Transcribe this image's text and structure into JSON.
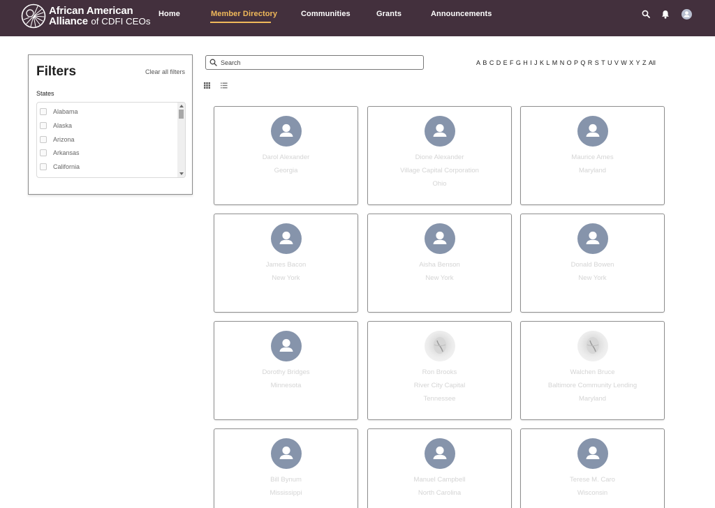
{
  "header": {
    "logo": {
      "line1": "African American",
      "line2": "Alliance",
      "line2_small": "of CDFI CEOs"
    },
    "nav": [
      "Home",
      "Member Directory",
      "Communities",
      "Grants",
      "Announcements"
    ],
    "active_nav": "Member Directory",
    "icons": [
      "search-icon",
      "bell-icon",
      "user-avatar-icon"
    ]
  },
  "filters": {
    "title": "Filters",
    "clear_label": "Clear all filters",
    "states_label": "States",
    "states": [
      "Alabama",
      "Alaska",
      "Arizona",
      "Arkansas",
      "California"
    ]
  },
  "search": {
    "placeholder": "Search"
  },
  "alphabet": [
    "A",
    "B",
    "C",
    "D",
    "E",
    "F",
    "G",
    "H",
    "I",
    "J",
    "K",
    "L",
    "M",
    "N",
    "O",
    "P",
    "Q",
    "R",
    "S",
    "T",
    "U",
    "V",
    "W",
    "X",
    "Y",
    "Z",
    "All"
  ],
  "view_icons": [
    "grid-view-icon",
    "list-view-icon"
  ],
  "members": [
    {
      "name": "Darol Alexander",
      "org": "",
      "state": "Georgia",
      "avatar": "default"
    },
    {
      "name": "Dione Alexander",
      "org": "Village Capital Corporation",
      "state": "Ohio",
      "avatar": "default"
    },
    {
      "name": "Maurice Ames",
      "org": "",
      "state": "Maryland",
      "avatar": "default"
    },
    {
      "name": "James Bacon",
      "org": "",
      "state": "New York",
      "avatar": "default"
    },
    {
      "name": "Aisha Benson",
      "org": "",
      "state": "New York",
      "avatar": "default"
    },
    {
      "name": "Donald Bowen",
      "org": "",
      "state": "New York",
      "avatar": "default"
    },
    {
      "name": "Dorothy Bridges",
      "org": "",
      "state": "Minnesota",
      "avatar": "default"
    },
    {
      "name": "Ron Brooks",
      "org": "River City Capital",
      "state": "Tennessee",
      "avatar": "photo"
    },
    {
      "name": "Walchen Bruce",
      "org": "Baltimore Community Lending",
      "state": "Maryland",
      "avatar": "photo"
    },
    {
      "name": "Bill Bynum",
      "org": "",
      "state": "Mississippi",
      "avatar": "default"
    },
    {
      "name": "Manuel Campbell",
      "org": "",
      "state": "North Carolina",
      "avatar": "default"
    },
    {
      "name": "Terese M. Caro",
      "org": "",
      "state": "Wisconsin",
      "avatar": "default"
    }
  ]
}
